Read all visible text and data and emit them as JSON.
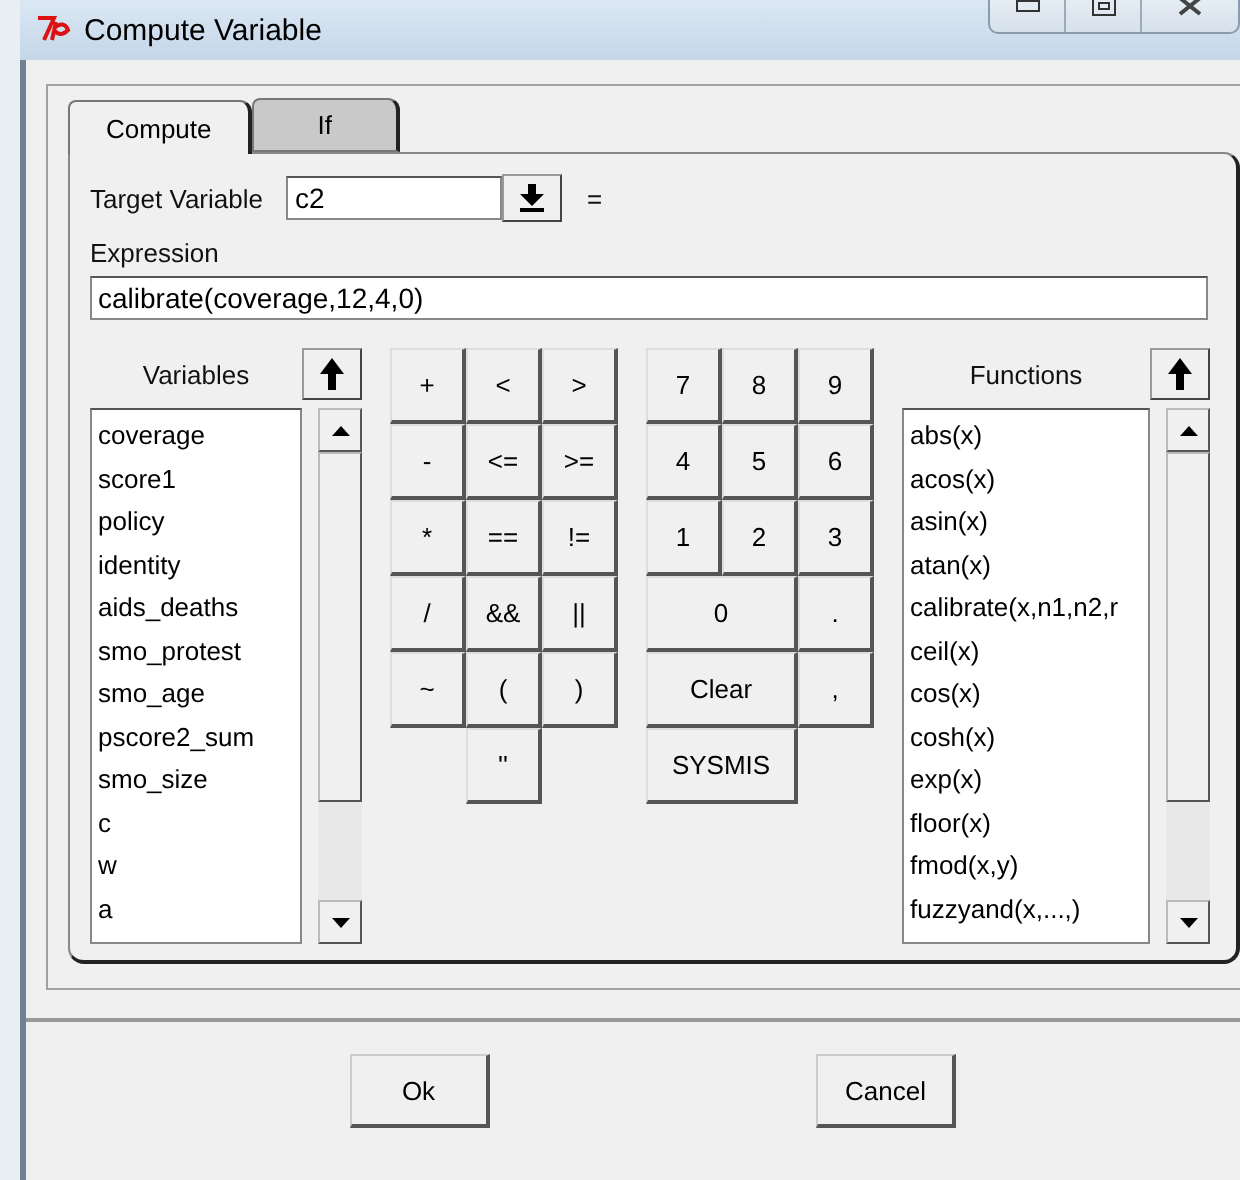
{
  "window": {
    "title": "Compute Variable"
  },
  "tabs": [
    {
      "label": "Compute",
      "selected": true
    },
    {
      "label": "If",
      "selected": false
    }
  ],
  "target": {
    "label": "Target Variable",
    "value": "c2",
    "equals": "="
  },
  "expression": {
    "label": "Expression",
    "value": "calibrate(coverage,12,4,0)"
  },
  "variables": {
    "label": "Variables",
    "items": [
      "coverage",
      "score1",
      "policy",
      "identity",
      "aids_deaths",
      "smo_protest",
      "smo_age",
      "pscore2_sum",
      "smo_size",
      "c",
      "w",
      "a"
    ]
  },
  "operators": [
    [
      {
        "label": "+"
      },
      {
        "label": "<"
      },
      {
        "label": ">"
      }
    ],
    [
      {
        "label": "-"
      },
      {
        "label": "<="
      },
      {
        "label": ">="
      }
    ],
    [
      {
        "label": "*"
      },
      {
        "label": "=="
      },
      {
        "label": "!="
      }
    ],
    [
      {
        "label": "/"
      },
      {
        "label": "&&"
      },
      {
        "label": "||"
      }
    ],
    [
      {
        "label": "~"
      },
      {
        "label": "("
      },
      {
        "label": ")"
      }
    ],
    [
      {
        "label": "''"
      }
    ]
  ],
  "numbers": [
    [
      {
        "label": "7",
        "wide": false
      },
      {
        "label": "8",
        "wide": false
      },
      {
        "label": "9",
        "wide": false
      }
    ],
    [
      {
        "label": "4",
        "wide": false
      },
      {
        "label": "5",
        "wide": false
      },
      {
        "label": "6",
        "wide": false
      }
    ],
    [
      {
        "label": "1",
        "wide": false
      },
      {
        "label": "2",
        "wide": false
      },
      {
        "label": "3",
        "wide": false
      }
    ],
    [
      {
        "label": "0",
        "wide": true
      },
      {
        "label": ".",
        "wide": false
      }
    ],
    [
      {
        "label": "Clear",
        "wide": true
      },
      {
        "label": ",",
        "wide": false
      }
    ],
    [
      {
        "label": "SYSMIS",
        "wide": true
      }
    ]
  ],
  "functions": {
    "label": "Functions",
    "items": [
      "abs(x)",
      "acos(x)",
      "asin(x)",
      "atan(x)",
      "calibrate(x,n1,n2,r",
      "ceil(x)",
      "cos(x)",
      "cosh(x)",
      "exp(x)",
      "floor(x)",
      "fmod(x,y)",
      "fuzzyand(x,...,)"
    ]
  },
  "buttons": [
    "Ok",
    "Cancel"
  ]
}
